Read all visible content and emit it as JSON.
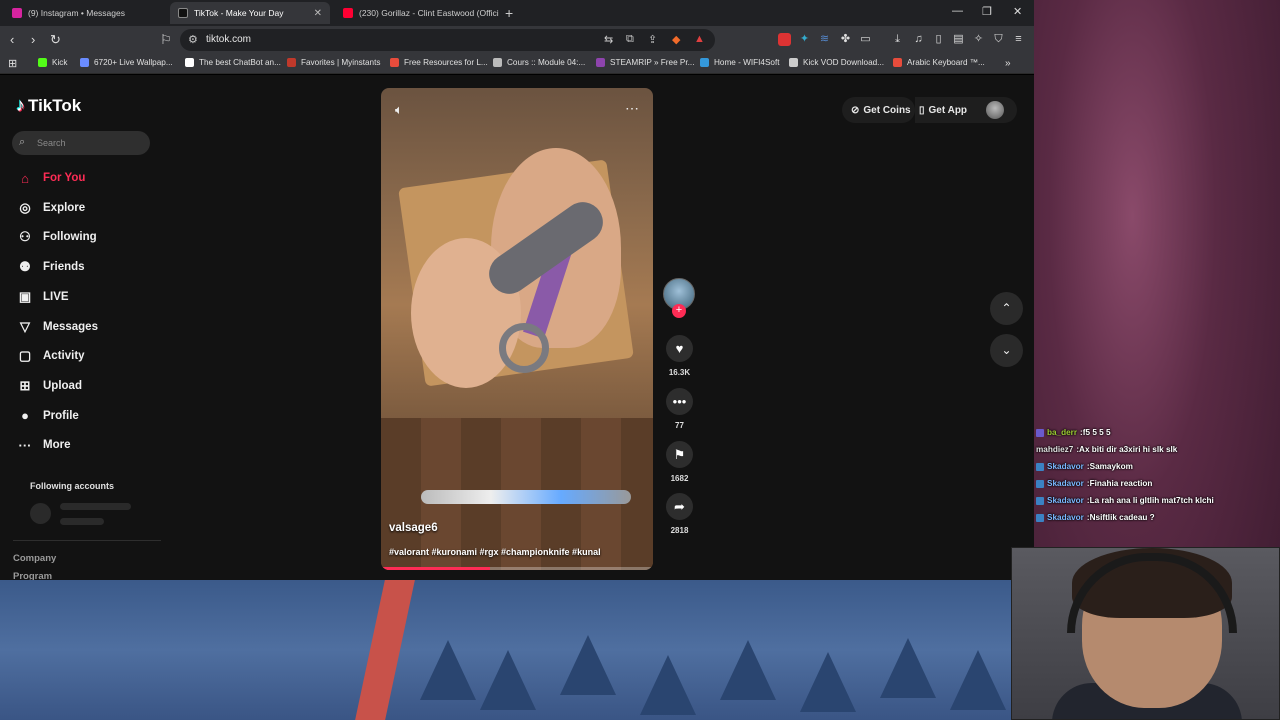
{
  "browser": {
    "tabs": [
      {
        "title": "(9) Instagram • Messages",
        "fav_color": "#d6249f",
        "active": false
      },
      {
        "title": "TikTok - Make Your Day",
        "fav_color": "#ffffff",
        "active": true
      },
      {
        "title": "(230) Gorillaz - Clint Eastwood (Offici",
        "fav_color": "#ff0033",
        "active": false
      }
    ],
    "new_tab": "+",
    "window_controls": {
      "minimize": "—",
      "restore": "❐",
      "close": "✕"
    },
    "url": "tiktok.com",
    "bookmarks": [
      {
        "label": "Kick",
        "color": "#53fc18"
      },
      {
        "label": "6720+ Live Wallpap...",
        "color": "#6a8cff"
      },
      {
        "label": "The best ChatBot an...",
        "color": "#ffffff"
      },
      {
        "label": "Favorites | Myinstants",
        "color": "#c0392b"
      },
      {
        "label": "Free Resources for L...",
        "color": "#e74c3c"
      },
      {
        "label": "Cours :: Module 04:...",
        "color": "#bbbbbb"
      },
      {
        "label": "STEAMRIP » Free Pr...",
        "color": "#8e44ad"
      },
      {
        "label": "Home - WIFI4Soft",
        "color": "#3498db"
      },
      {
        "label": "Kick VOD Download...",
        "color": "#cccccc"
      },
      {
        "label": "Arabic Keyboard ™...",
        "color": "#e74c3c"
      }
    ]
  },
  "tiktok": {
    "logo": "TikTok",
    "search_placeholder": "Search",
    "nav": [
      {
        "label": "For You",
        "icon": "home-icon",
        "glyph": "⌂",
        "active": true
      },
      {
        "label": "Explore",
        "icon": "compass-icon",
        "glyph": "◎",
        "active": false
      },
      {
        "label": "Following",
        "icon": "person-icon",
        "glyph": "⚇",
        "active": false
      },
      {
        "label": "Friends",
        "icon": "friends-icon",
        "glyph": "⚉",
        "active": false
      },
      {
        "label": "LIVE",
        "icon": "live-icon",
        "glyph": "▣",
        "active": false
      },
      {
        "label": "Messages",
        "icon": "messages-icon",
        "glyph": "▽",
        "active": false
      },
      {
        "label": "Activity",
        "icon": "activity-icon",
        "glyph": "▢",
        "active": false
      },
      {
        "label": "Upload",
        "icon": "upload-icon",
        "glyph": "⊞",
        "active": false
      },
      {
        "label": "Profile",
        "icon": "profile-icon",
        "glyph": "●",
        "active": false
      },
      {
        "label": "More",
        "icon": "more-icon",
        "glyph": "···",
        "active": false
      }
    ],
    "following_accounts": "Following accounts",
    "footer_links": [
      "Company",
      "Program"
    ],
    "get_coins": "Get Coins",
    "get_app": "Get App",
    "video": {
      "author": "valsage6",
      "caption": "#valorant #kuronami #rgx #championknife #kunal",
      "progress": 0.4
    },
    "actions": {
      "likes": "16.3K",
      "comments": "77",
      "saves": "1682",
      "shares": "2818"
    }
  },
  "chat": [
    {
      "user": "ba_derr",
      "msg": "f5 5 5 5",
      "color": "#9acd32",
      "badge": "#6a5acd"
    },
    {
      "user": "mahdiez7",
      "msg": "Ax biti dir a3xiri hi slk slk",
      "color": "#e0e0e0",
      "badge": ""
    },
    {
      "user": "Skadavor",
      "msg": "Samaykom",
      "color": "#7ab8ff",
      "badge": "#3b82c4"
    },
    {
      "user": "Skadavor",
      "msg": "Finahia reaction",
      "color": "#7ab8ff",
      "badge": "#3b82c4"
    },
    {
      "user": "Skadavor",
      "msg": "La rah ana li gltlih mat7tch klchi",
      "color": "#7ab8ff",
      "badge": "#3b82c4"
    },
    {
      "user": "Skadavor",
      "msg": "Nsiftlik cadeau ?",
      "color": "#7ab8ff",
      "badge": "#3b82c4"
    }
  ]
}
